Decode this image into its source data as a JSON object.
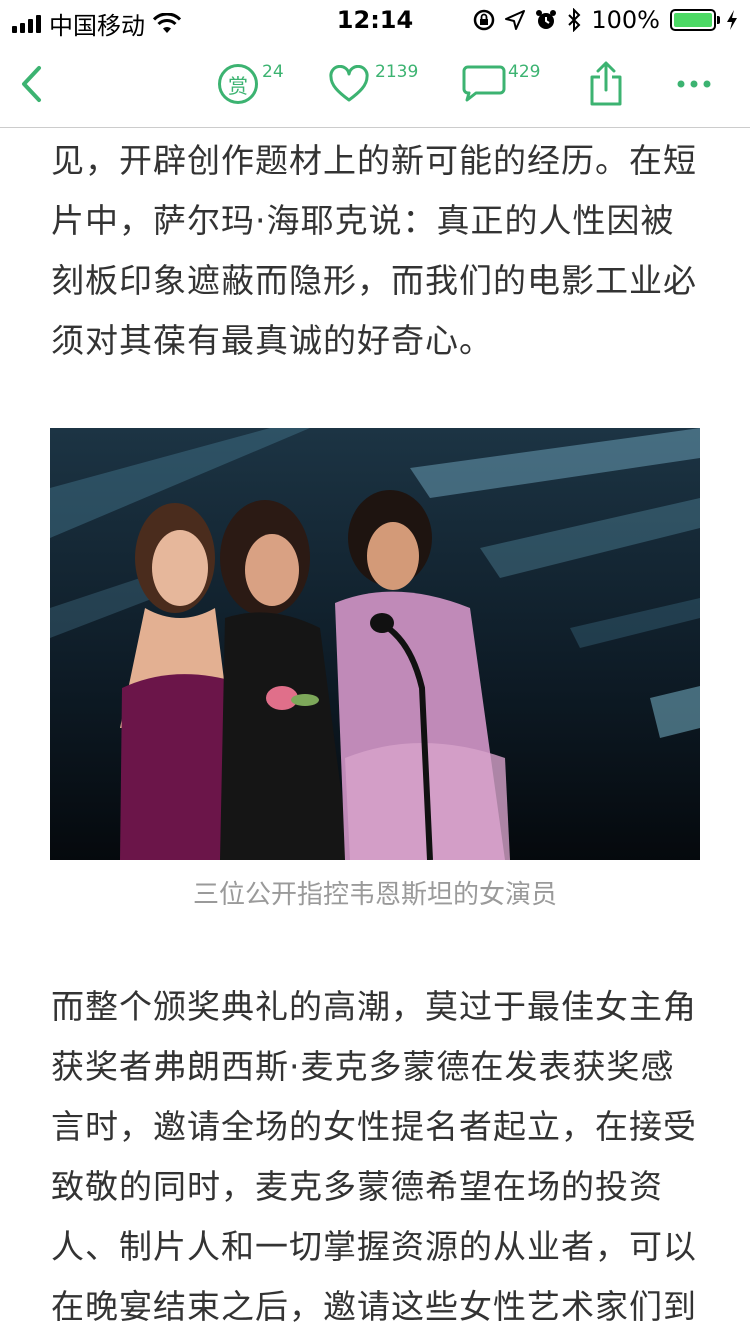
{
  "status_bar": {
    "carrier": "中国移动",
    "time": "12:14",
    "battery": "100%",
    "battery_level": 1.0
  },
  "toolbar": {
    "reward_label": "赏",
    "reward_count": "24",
    "like_count": "2139",
    "comment_count": "429",
    "accent_color": "#3cb371"
  },
  "article": {
    "paragraph_1": "见，开辟创作题材上的新可能的经历。在短片中，萨尔玛·海耶克说：真正的人性因被刻板印象遮蔽而隐形，而我们的电影工业必须对其葆有最真诚的好奇心。",
    "image_caption": "三位公开指控韦恩斯坦的女演员",
    "paragraph_2": "而整个颁奖典礼的高潮，莫过于最佳女主角获奖者弗朗西斯·麦克多蒙德在发表获奖感言时，邀请全场的女性提名者起立，在接受致敬的同时，麦克多蒙德希望在场的投资人、制片人和一切掌握资源的从业者，可以在晚宴结束之后，邀请这些女性艺术家们到"
  },
  "icons": [
    "signal-icon",
    "wifi-icon",
    "lock-rotation-icon",
    "location-icon",
    "alarm-icon",
    "bluetooth-icon",
    "battery-icon",
    "charging-icon",
    "back-icon",
    "reward-icon",
    "heart-icon",
    "comment-icon",
    "share-icon",
    "more-icon"
  ]
}
